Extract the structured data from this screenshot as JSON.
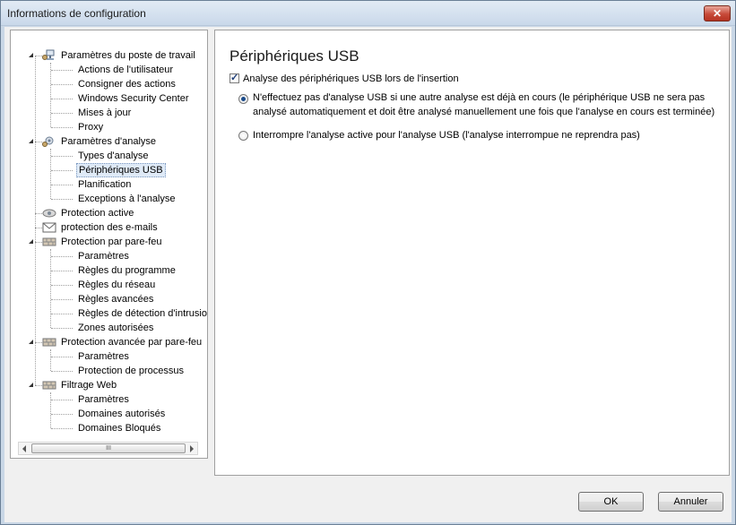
{
  "window": {
    "title": "Informations de configuration",
    "close_glyph": "✕"
  },
  "tree": {
    "groups": [
      {
        "label": "Paramètres du poste de travail",
        "icon": "workstation-icon",
        "items": [
          "Actions de l'utilisateur",
          "Consigner des actions",
          "Windows Security Center",
          "Mises à jour",
          "Proxy"
        ]
      },
      {
        "label": "Paramètres d'analyse",
        "icon": "scan-settings-icon",
        "items": [
          "Types d'analyse",
          "Périphériques USB",
          "Planification",
          "Exceptions à l'analyse"
        ]
      },
      {
        "label": "Protection active",
        "icon": "active-protection-icon",
        "items": []
      },
      {
        "label": "protection des e-mails",
        "icon": "email-icon",
        "items": []
      },
      {
        "label": "Protection par pare-feu",
        "icon": "firewall-icon",
        "items": [
          "Paramètres",
          "Règles du programme",
          "Règles du réseau",
          "Règles avancées",
          "Règles de détection d'intrusio",
          "Zones autorisées"
        ]
      },
      {
        "label": "Protection avancée par pare-feu",
        "icon": "firewall-icon",
        "items": [
          "Paramètres",
          "Protection de processus"
        ]
      },
      {
        "label": "Filtrage Web",
        "icon": "firewall-icon",
        "items": [
          "Paramètres",
          "Domaines autorisés",
          "Domaines Bloqués"
        ]
      }
    ],
    "selected": "Périphériques USB",
    "scroll_thumb": "III"
  },
  "content": {
    "title": "Périphériques USB",
    "usb_scan_checkbox": {
      "label": "Analyse des périphériques USB lors de l'insertion",
      "checked": true
    },
    "options": [
      {
        "line1": "N'effectuez pas d'analyse USB si une autre analyse est déjà en cours (le périphérique USB ne sera pas",
        "line2": "analysé automatiquement et doit être analysé manuellement une fois que l'analyse en cours est terminée)",
        "checked": true
      },
      {
        "line1": "Interrompre l'analyse active pour l'analyse USB (l'analyse interrompue ne reprendra pas)",
        "checked": false
      }
    ]
  },
  "buttons": {
    "ok": "OK",
    "cancel": "Annuler"
  }
}
